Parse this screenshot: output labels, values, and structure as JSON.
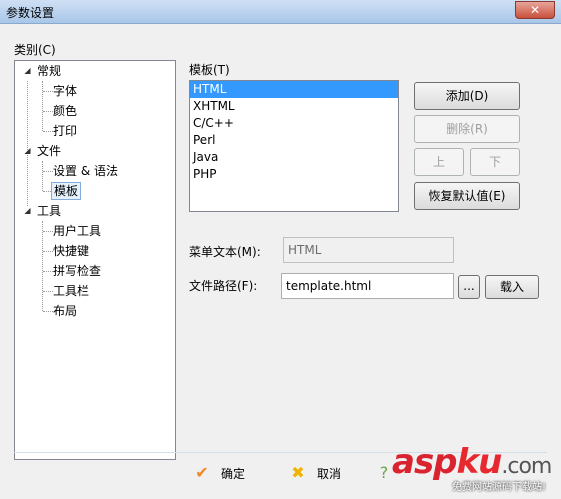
{
  "window": {
    "title": "参数设置",
    "close": "✕"
  },
  "category": {
    "label": "类别(C)",
    "groups": [
      {
        "label": "常规",
        "items": [
          "字体",
          "颜色",
          "打印"
        ]
      },
      {
        "label": "文件",
        "items": [
          "设置 & 语法",
          "模板"
        ]
      },
      {
        "label": "工具",
        "items": [
          "用户工具",
          "快捷键",
          "拼写检查",
          "工具栏",
          "布局"
        ]
      }
    ],
    "selected": "模板"
  },
  "templates": {
    "label": "模板(T)",
    "items": [
      "HTML",
      "XHTML",
      "C/C++",
      "Perl",
      "Java",
      "PHP"
    ],
    "selected": "HTML"
  },
  "buttons": {
    "add": "添加(D)",
    "delete": "删除(R)",
    "up": "上",
    "down": "下",
    "restore": "恢复默认值(E)",
    "browse": "...",
    "load": "载入"
  },
  "fields": {
    "menu_text_label": "菜单文本(M):",
    "menu_text_value": "HTML",
    "file_path_label": "文件路径(F):",
    "file_path_value": "template.html"
  },
  "footer": {
    "ok": "确定",
    "cancel": "取消",
    "help_partial": "?"
  },
  "watermark": {
    "text_a": "asp",
    "text_b": "ku",
    "text_c": ".com",
    "subtext": "免费网站源码下载站!"
  },
  "colors": {
    "selection": "#3399ff",
    "tree_selected": "#e5f1fb",
    "ok_icon": "#f08a24",
    "cancel_icon": "#f0b400"
  }
}
